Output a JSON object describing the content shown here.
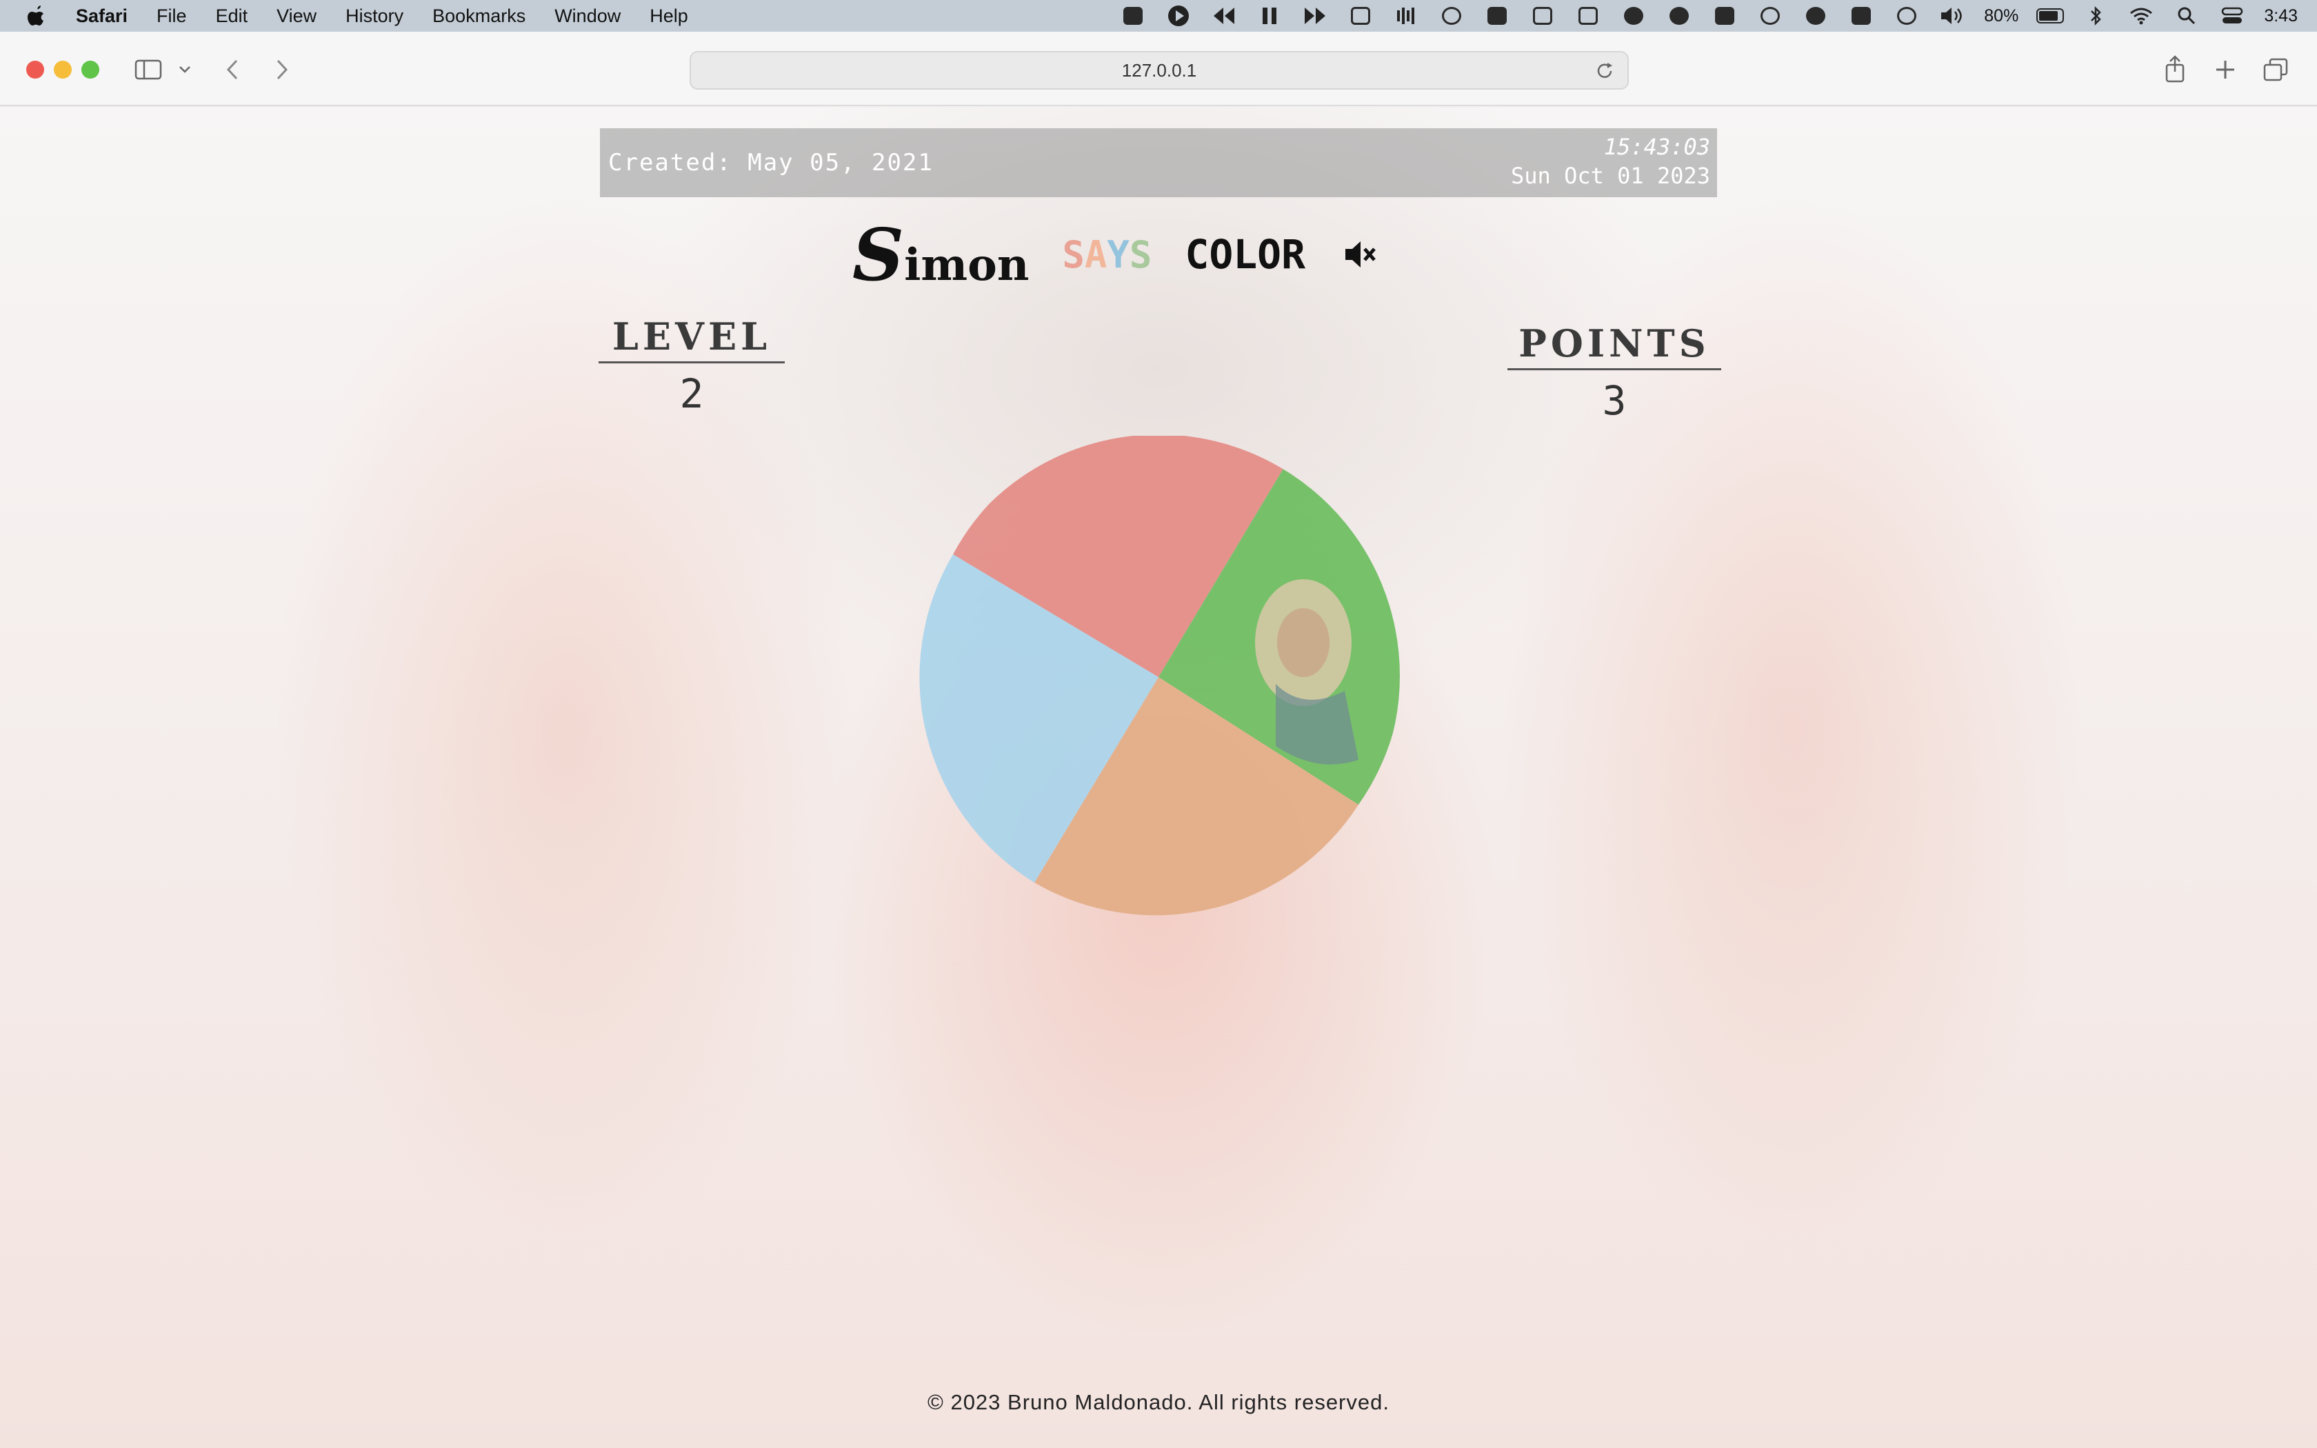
{
  "menubar": {
    "app": "Safari",
    "items": [
      "File",
      "Edit",
      "View",
      "History",
      "Bookmarks",
      "Window",
      "Help"
    ],
    "battery": "80%",
    "time": "3:43"
  },
  "browser": {
    "url": "127.0.0.1"
  },
  "game": {
    "created": "Created: May 05, 2021",
    "clock_time": "15:43:03",
    "clock_date": "Sun Oct 01 2023",
    "title_simon": "Simon",
    "title_says": "SAYS",
    "title_color": "COLOR",
    "level_label": "LEVEL",
    "level_value": "2",
    "points_label": "POINTS",
    "points_value": "3",
    "pads": {
      "red": "#e48b86",
      "green": "#6cbd5f",
      "orange": "#e3ac85",
      "blue": "#a9d4ea"
    },
    "says_colors": [
      "#e9a294",
      "#f2b79b",
      "#93c3dd",
      "#a7c99b"
    ]
  },
  "footer": {
    "text": "© 2023 Bruno Maldonado. All rights reserved."
  }
}
